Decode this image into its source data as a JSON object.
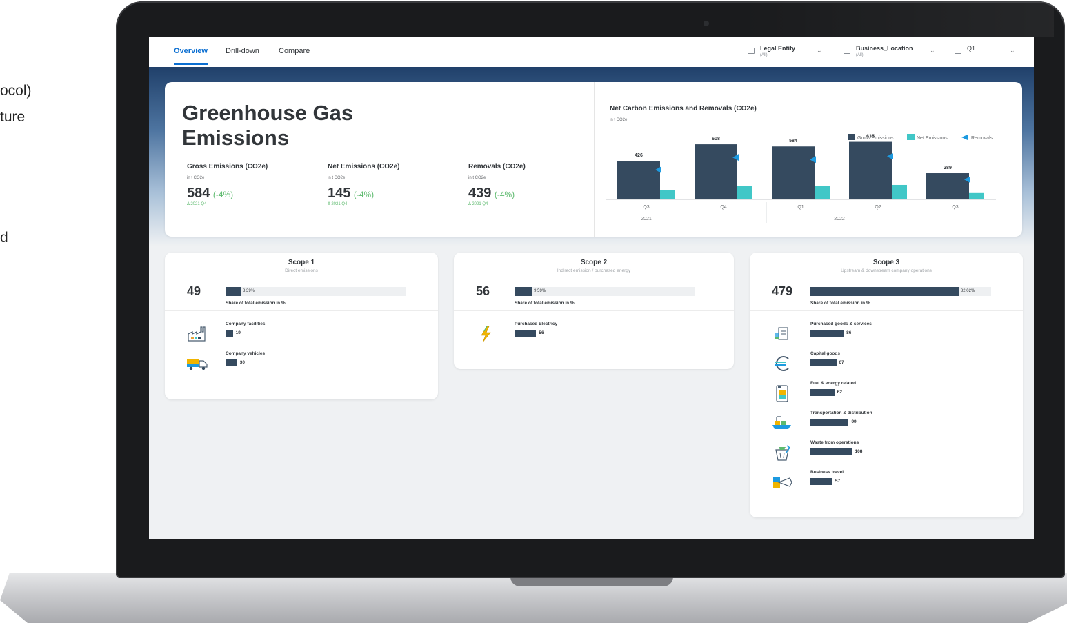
{
  "slide_fragments": [
    "ocol)",
    "ture",
    "d"
  ],
  "nav": {
    "tabs": [
      {
        "label": "Overview",
        "active": true
      },
      {
        "label": "Drill-down",
        "active": false
      },
      {
        "label": "Compare",
        "active": false
      }
    ],
    "filters": [
      {
        "label": "Legal Entity",
        "value": "(All)"
      },
      {
        "label": "Business_Location",
        "value": "(All)"
      },
      {
        "label": "Q1",
        "value": ""
      }
    ]
  },
  "header": {
    "title": "Greenhouse Gas Emissions",
    "kpis": [
      {
        "label": "Gross Emissions (CO2e)",
        "unit": "in t CO2e",
        "value": "584",
        "delta": "(-4%)",
        "compare": "Δ 2021 Q4"
      },
      {
        "label": "Net Emissions (CO2e)",
        "unit": "in t CO2e",
        "value": "145",
        "delta": "(-4%)",
        "compare": "Δ 2021 Q4"
      },
      {
        "label": "Removals (CO2e)",
        "unit": "in t CO2e",
        "value": "439",
        "delta": "(-4%)",
        "compare": "Δ 2021 Q4"
      }
    ]
  },
  "chart_data": {
    "type": "bar",
    "title": "Net Carbon Emissions and Removals (CO2e)",
    "subtitle": "in t CO2e",
    "categories": [
      "Q3",
      "Q4",
      "Q1",
      "Q2",
      "Q3"
    ],
    "groups": [
      {
        "label": "2021",
        "span": [
          0,
          1
        ]
      },
      {
        "label": "2022",
        "span": [
          2,
          4
        ]
      }
    ],
    "series": [
      {
        "name": "Gross Emissions",
        "values": [
          426,
          608,
          584,
          635,
          289
        ],
        "color": "#354a5f"
      },
      {
        "name": "Net Emissions",
        "values": [
          100,
          145,
          145,
          160,
          70
        ],
        "color": "#41c7c7"
      },
      {
        "name": "Removals",
        "values": [
          326,
          463,
          439,
          475,
          219
        ],
        "color": "#1d9ae0"
      }
    ],
    "data_labels": [
      "426",
      "608",
      "584",
      "635",
      "289"
    ],
    "ylim": [
      0,
      700
    ],
    "legend_position": "top-right"
  },
  "scopes": [
    {
      "title": "Scope 1",
      "subtitle": "Direct emissions",
      "total": "49",
      "share": 8.39,
      "share_label": "8.39%",
      "share_caption": "Share of total emission in %",
      "items": [
        {
          "label": "Company facilities",
          "value": 19,
          "value_label": "19",
          "icon": "factory-icon"
        },
        {
          "label": "Company vehicles",
          "value": 30,
          "value_label": "30",
          "icon": "truck-icon"
        }
      ]
    },
    {
      "title": "Scope 2",
      "subtitle": "Indirect emission / purchased energy",
      "total": "56",
      "share": 9.59,
      "share_label": "9.59%",
      "share_caption": "Share of total emission in %",
      "items": [
        {
          "label": "Purchased Electricy",
          "value": 56,
          "value_label": "56",
          "icon": "lightning-icon"
        }
      ]
    },
    {
      "title": "Scope 3",
      "subtitle": "Upstream & downstream company operations",
      "total": "479",
      "share": 82.02,
      "share_label": "82.02%",
      "share_caption": "Share of total emission in %",
      "items": [
        {
          "label": "Purchased goods & services",
          "value": 86,
          "value_label": "86",
          "icon": "shopping-icon"
        },
        {
          "label": "Capital goods",
          "value": 67,
          "value_label": "67",
          "icon": "euro-icon"
        },
        {
          "label": "Fuel & energy related",
          "value": 62,
          "value_label": "62",
          "icon": "fuel-icon"
        },
        {
          "label": "Transportation & distribution",
          "value": 99,
          "value_label": "99",
          "icon": "ship-icon"
        },
        {
          "label": "Waste from operations",
          "value": 108,
          "value_label": "108",
          "icon": "waste-icon"
        },
        {
          "label": "Business travel",
          "value": 57,
          "value_label": "57",
          "icon": "airplane-icon"
        }
      ]
    }
  ],
  "colors": {
    "accent": "#0a6ed1",
    "bar": "#354a5f",
    "net": "#41c7c7",
    "removal": "#1d9ae0",
    "positive": "#5dba6e"
  }
}
